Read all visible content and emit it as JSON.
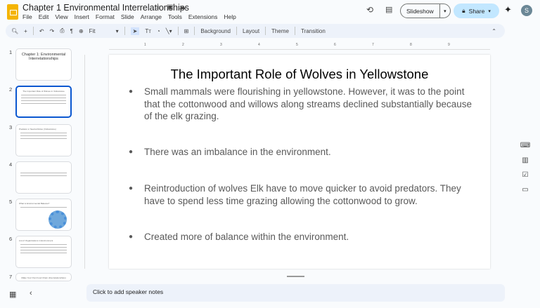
{
  "doc": {
    "title": "Chapter 1 Environmental Interrelationships"
  },
  "menu": [
    "File",
    "Edit",
    "View",
    "Insert",
    "Format",
    "Slide",
    "Arrange",
    "Tools",
    "Extensions",
    "Help"
  ],
  "header": {
    "slideshow": "Slideshow",
    "share": "Share",
    "avatar": "S"
  },
  "toolbar": {
    "zoom": "Fit",
    "background": "Background",
    "layout": "Layout",
    "theme": "Theme",
    "transition": "Transition"
  },
  "thumbnails": [
    {
      "num": "1",
      "title": "Chapter 1: Environmental Interrelationships"
    },
    {
      "num": "2",
      "title": "The Important Role of Wolves in Yellowstone"
    },
    {
      "num": "3",
      "title": "Predator or Neutral Roles (Yellowstone)"
    },
    {
      "num": "4",
      "title": ""
    },
    {
      "num": "5",
      "title": "What is Environmental Balance?"
    },
    {
      "num": "6",
      "title": "List of Organizations in Environment"
    },
    {
      "num": "7",
      "title": "Make Your Own Food Chain (Interrelationships)"
    }
  ],
  "ruler": [
    "1",
    "2",
    "3",
    "4",
    "5",
    "6",
    "7",
    "8",
    "9"
  ],
  "slide": {
    "title": "The Important Role of Wolves in Yellowstone",
    "bullets": [
      "Small mammals were flourishing in yellowstone. However, it was to the point that the cottonwood and willows along streams declined substantially because of the elk grazing.",
      "There was an imbalance in the environment.",
      "Reintroduction of wolves Elk have to move quicker to avoid predators. They have to spend less time grazing allowing the cottonwood to grow.",
      "Created more of balance within the environment."
    ]
  },
  "notes": {
    "placeholder": "Click to add speaker notes"
  },
  "colors": {
    "accent": "#0b57d0",
    "share": "#c2e7ff",
    "logo": "#f4b400"
  }
}
